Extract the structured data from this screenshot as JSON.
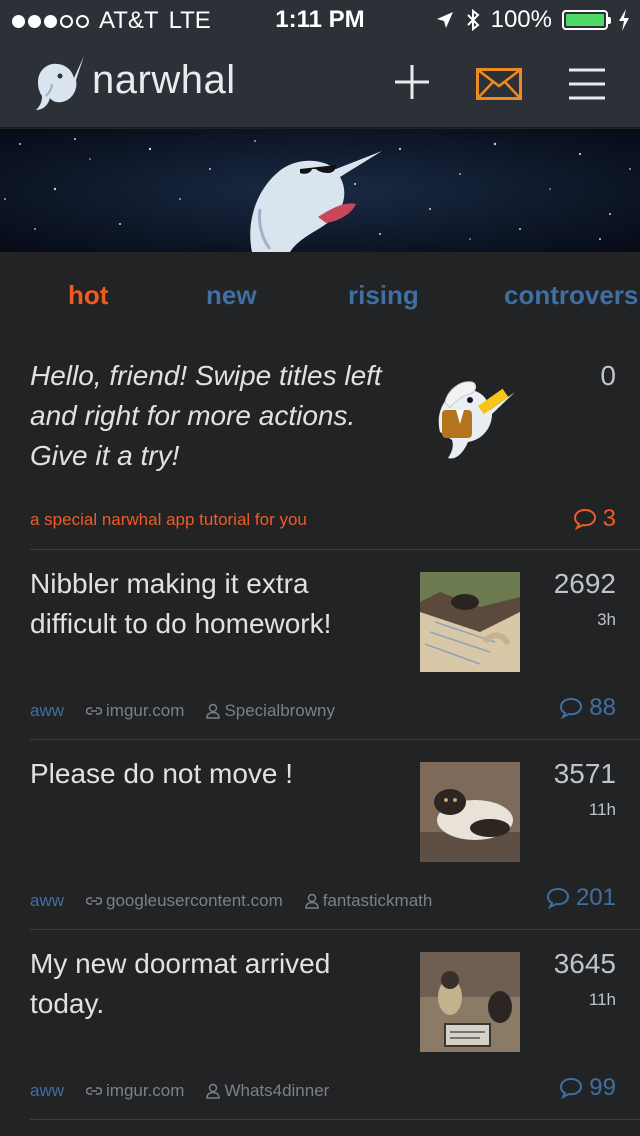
{
  "status_bar": {
    "carrier": "AT&T",
    "network": "LTE",
    "time": "1:11 PM",
    "battery": "100%",
    "signal_bars_filled": 3,
    "signal_bars_total": 5
  },
  "navbar": {
    "app_name": "narwhal",
    "icons": [
      "narwhal-logo-icon",
      "plus-icon",
      "mail-icon",
      "hamburger-menu-icon"
    ]
  },
  "tabs": [
    {
      "label": "hot",
      "active": true
    },
    {
      "label": "new",
      "active": false
    },
    {
      "label": "rising",
      "active": false
    },
    {
      "label": "controvers",
      "active": false
    }
  ],
  "posts": [
    {
      "title": "Hello, friend! Swipe titles left and right for more actions. Give it a try!",
      "score": "0",
      "meta_text": "a special narwhal app tutorial for you",
      "comments": "3"
    },
    {
      "title": "Nibbler making it extra difficult to do homework!",
      "score": "2692",
      "age": "3h",
      "subreddit": "aww",
      "domain": "imgur.com",
      "author": "Specialbrowny",
      "comments": "88"
    },
    {
      "title": "Please do not move !",
      "score": "3571",
      "age": "11h",
      "subreddit": "aww",
      "domain": "googleusercontent.com",
      "author": "fantastickmath",
      "comments": "201"
    },
    {
      "title": "My new doormat arrived today.",
      "score": "3645",
      "age": "11h",
      "subreddit": "aww",
      "domain": "imgur.com",
      "author": "Whats4dinner",
      "comments": "99"
    }
  ],
  "colors": {
    "accent_orange": "#ef5b22",
    "link_blue": "#3f6fa3",
    "background": "#222325",
    "navbar": "#2c3037"
  }
}
